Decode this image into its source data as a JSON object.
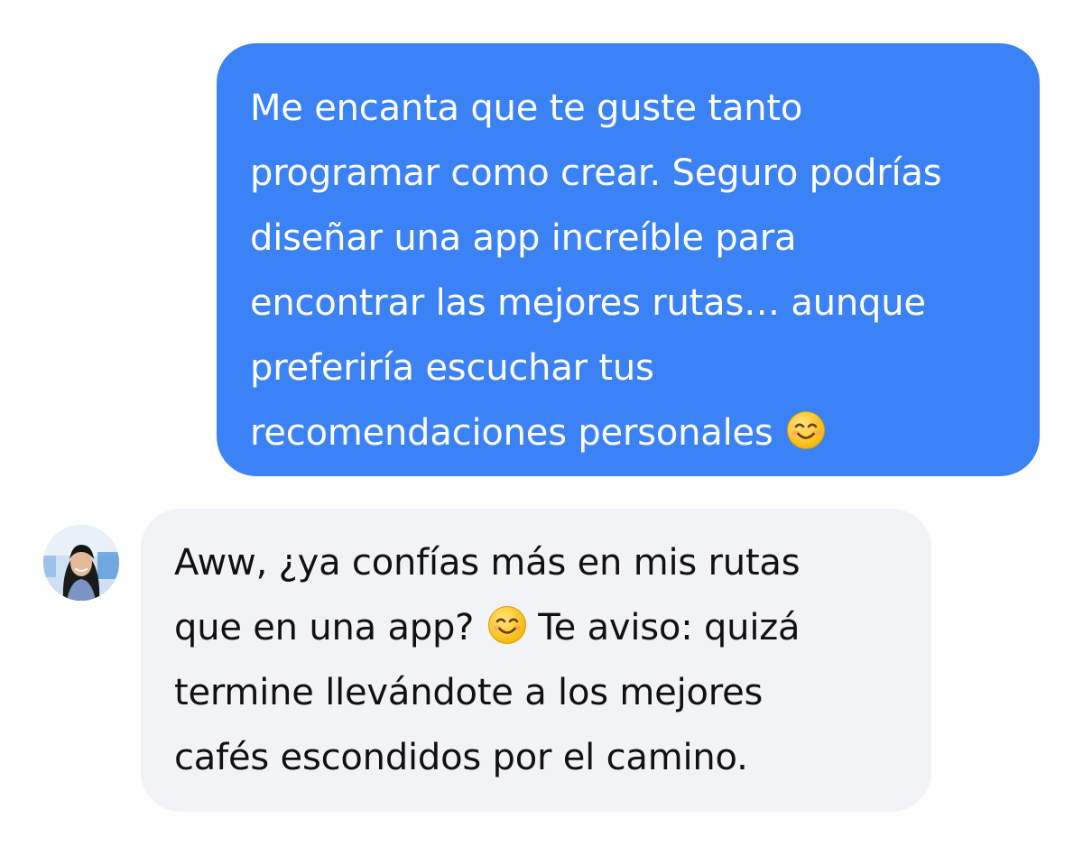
{
  "conversation": {
    "messages": [
      {
        "sender": "user",
        "lines": [
          "Me encanta que te guste tanto",
          "programar como crear. Seguro podrías",
          "diseñar una app increíble para",
          "encontrar las mejores rutas… aunque",
          "preferiría escuchar tus",
          "recomendaciones personales"
        ],
        "emoji": "smiling-face-emoji"
      },
      {
        "sender": "contact",
        "lines": [
          "Aww, ¿ya confías más en mis rutas",
          "que en una app?",
          "Te aviso: quizá",
          "termine llevándote a los mejores",
          "cafés escondidos por el camino."
        ],
        "emoji": "smiling-face-emoji"
      }
    ]
  },
  "colors": {
    "outgoing_bubble": "#3b82f6",
    "incoming_bubble": "#f2f3f7",
    "outgoing_text": "#ffffff",
    "incoming_text": "#111111"
  }
}
